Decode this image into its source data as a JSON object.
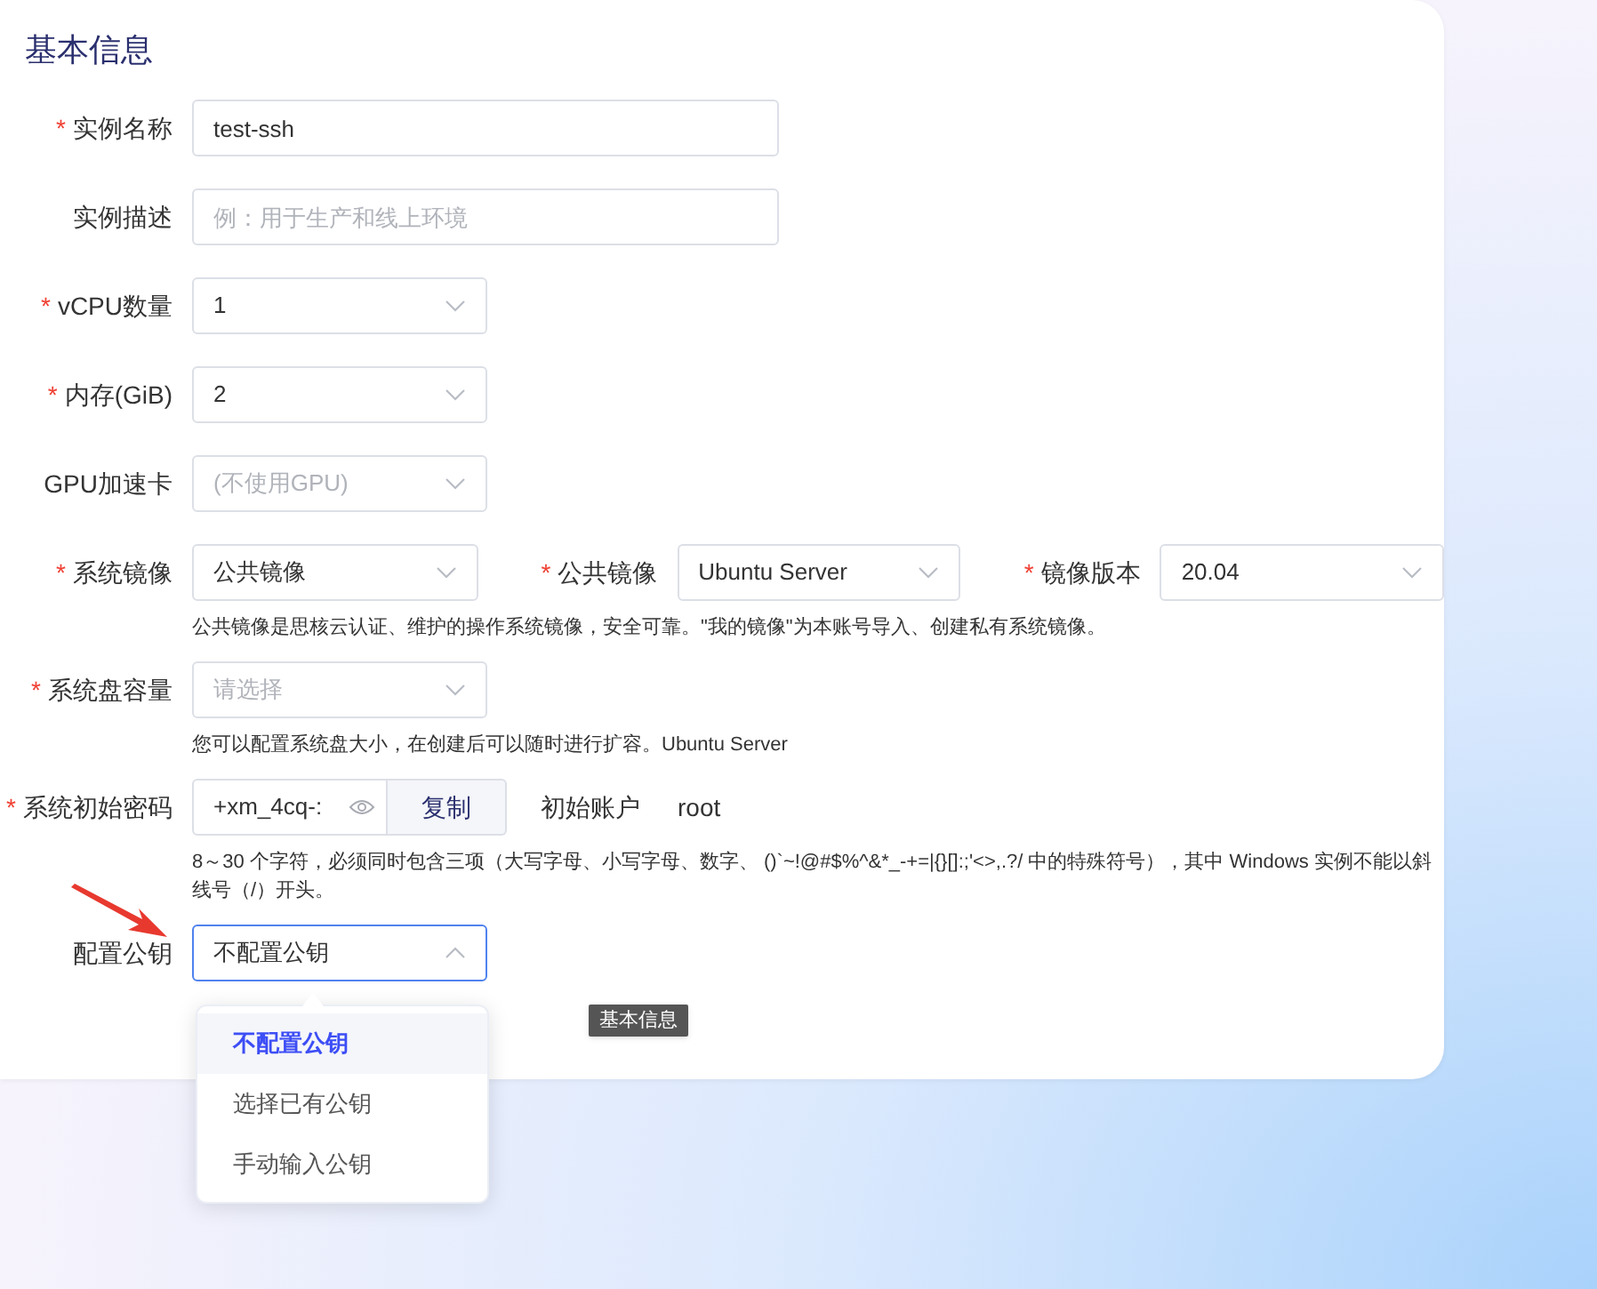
{
  "title": "基本信息",
  "required_mark": "*",
  "fields": [
    {
      "kind": "text",
      "label": "实例名称",
      "required": true,
      "value": "test-ssh"
    },
    {
      "kind": "text",
      "label": "实例描述",
      "required": false,
      "placeholder": "例：用于生产和线上环境"
    },
    {
      "kind": "select",
      "label": "vCPU数量",
      "required": true,
      "value": "1"
    },
    {
      "kind": "select",
      "label": "内存(GiB)",
      "required": true,
      "value": "2"
    },
    {
      "kind": "select",
      "label": "GPU加速卡",
      "required": false,
      "placeholder": "(不使用GPU)"
    },
    {
      "kind": "select",
      "label": "系统镜像",
      "required": true,
      "value": "公共镜像",
      "extra": [
        {
          "label": "公共镜像",
          "required": true,
          "value": "Ubuntu Server"
        },
        {
          "label": "镜像版本",
          "required": true,
          "value": "20.04"
        }
      ],
      "help": "公共镜像是思核云认证、维护的操作系统镜像，安全可靠。\"我的镜像\"为本账号导入、创建私有系统镜像。"
    },
    {
      "kind": "select",
      "label": "系统盘容量",
      "required": true,
      "placeholder": "请选择",
      "help": "您可以配置系统盘大小，在创建后可以随时进行扩容。Ubuntu Server"
    },
    {
      "kind": "password",
      "label": "系统初始密码",
      "required": true,
      "value": "+xm_4cq-:",
      "button": "复制",
      "account_label": "初始账户",
      "account": "root",
      "help": "8～30 个字符，必须同时包含三项（大写字母、小写字母、数字、 ()`~!@#$%^&*_-+=|{}[]:;'<>,.?/ 中的特殊符号），其中 Windows 实例不能以斜线号（/）开头。"
    },
    {
      "kind": "dropdown",
      "label": "配置公钥",
      "required": false,
      "value": "不配置公钥",
      "open": true,
      "options": [
        {
          "label": "不配置公钥",
          "selected": true
        },
        {
          "label": "选择已有公钥",
          "selected": false
        },
        {
          "label": "手动输入公钥",
          "selected": false
        }
      ]
    }
  ],
  "tooltip": "基本信息"
}
